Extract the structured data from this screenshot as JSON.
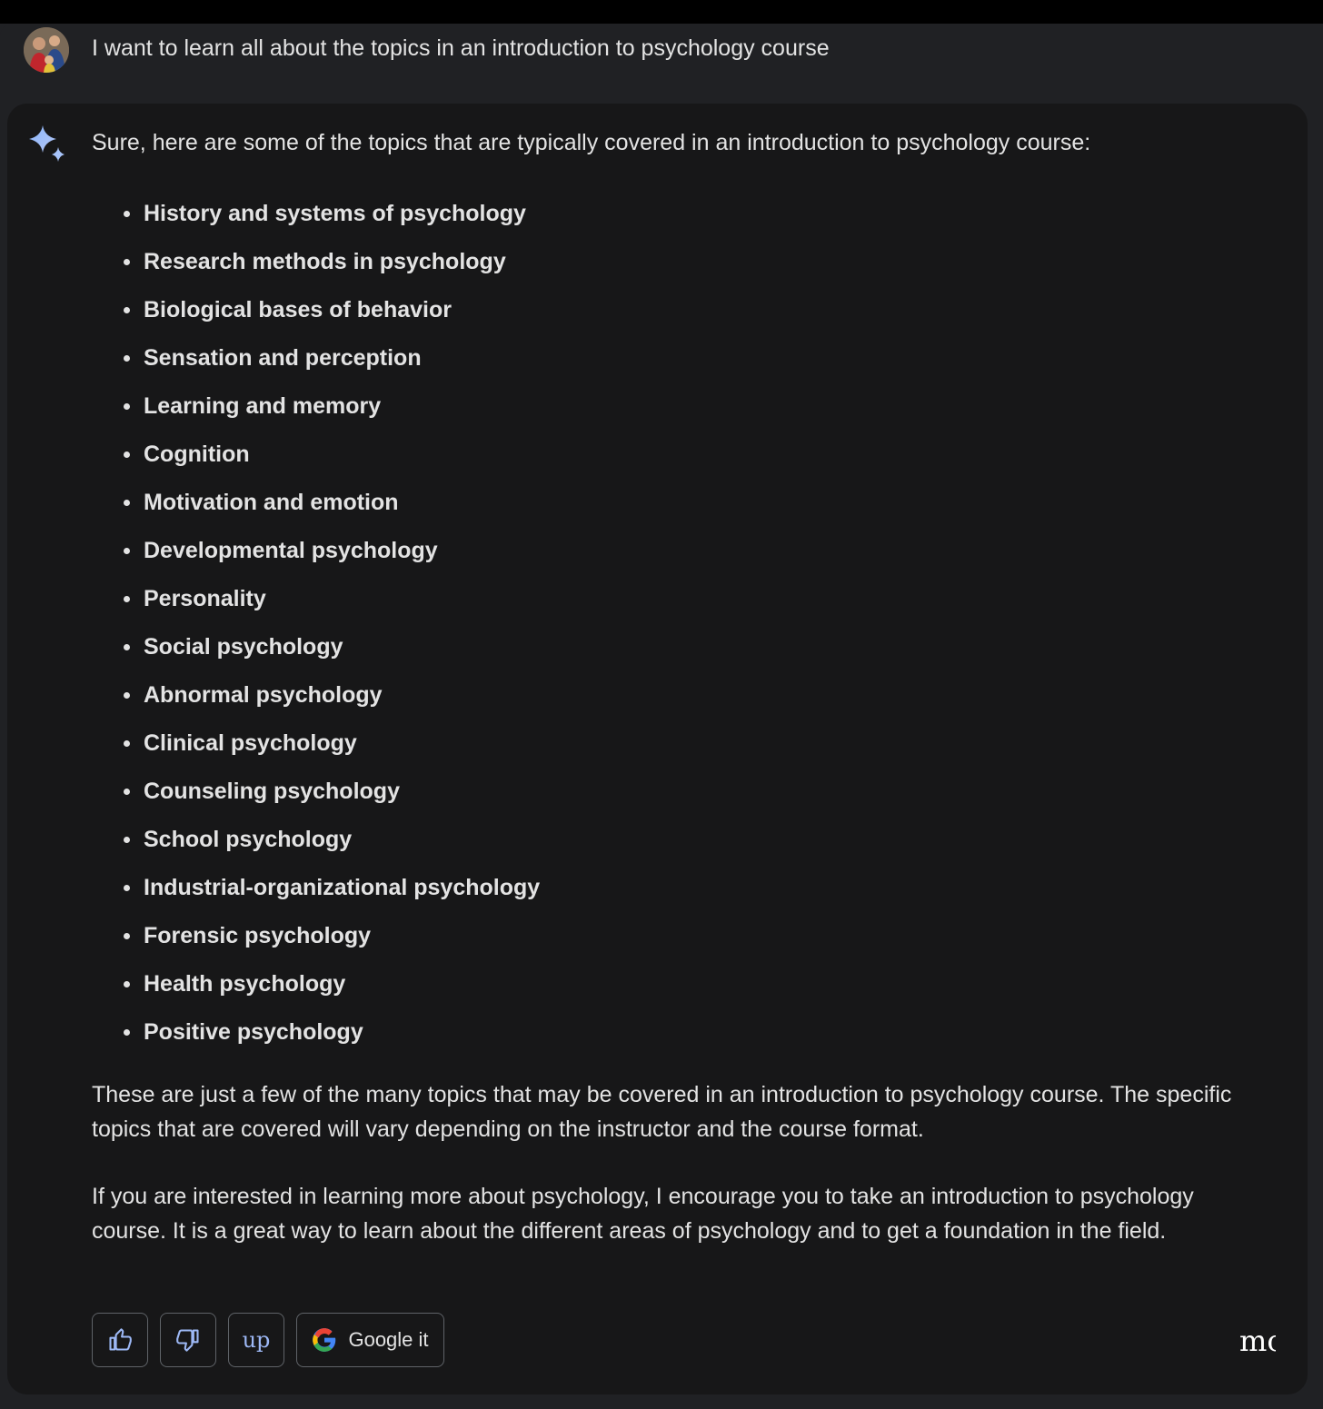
{
  "user_message": {
    "text": "I want to learn all about the topics in an introduction to psychology course"
  },
  "response": {
    "intro": "Sure, here are some of the topics that are typically covered in an introduction to psychology course:",
    "topics": [
      "History and systems of psychology",
      "Research methods in psychology",
      "Biological bases of behavior",
      "Sensation and perception",
      "Learning and memory",
      "Cognition",
      "Motivation and emotion",
      "Developmental psychology",
      "Personality",
      "Social psychology",
      "Abnormal psychology",
      "Clinical psychology",
      "Counseling psychology",
      "School psychology",
      "Industrial-organizational psychology",
      "Forensic psychology",
      "Health psychology",
      "Positive psychology"
    ],
    "paragraph_1": "These are just a few of the many topics that may be covered in an introduction to psychology course. The specific topics that are covered will vary depending on the instructor and the course format.",
    "paragraph_2": "If you are interested in learning more about psychology, I encourage you to take an introduction to psychology course. It is a great way to learn about the different areas of psychology and to get a foundation in the field."
  },
  "actions": {
    "thumbs_up_icon": "thumbs-up-icon",
    "thumbs_down_icon": "thumbs-down-icon",
    "up_label": "up",
    "google_label": "Google it",
    "more_label": "mo"
  },
  "colors": {
    "page_bg": "#202124",
    "card_bg": "#171718",
    "text": "#e3e3e3",
    "accent": "#9db8f5",
    "border": "#5f6368"
  }
}
